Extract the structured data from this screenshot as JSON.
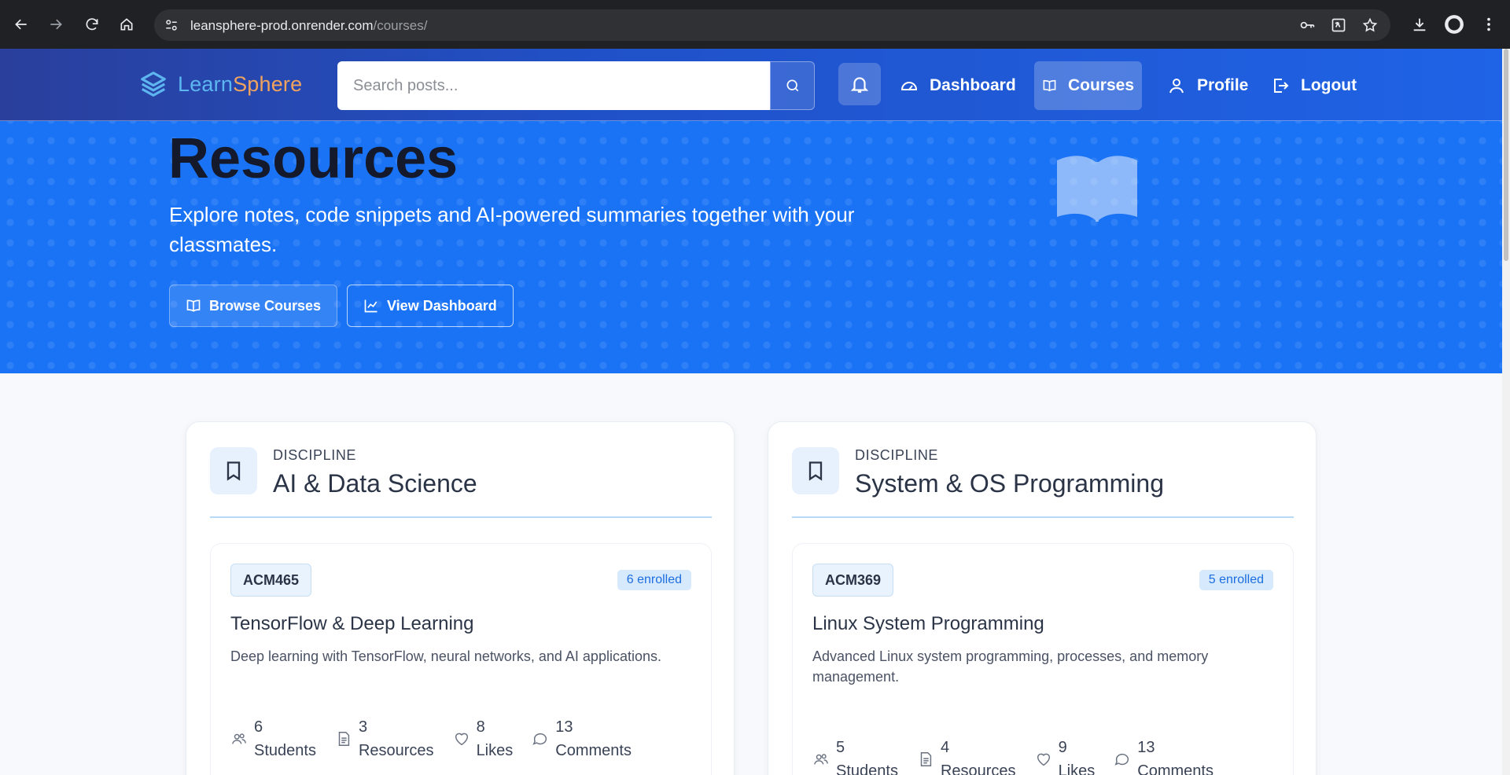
{
  "browser": {
    "url_host": "leansphere-prod.onrender.com",
    "url_path": "/courses/"
  },
  "nav": {
    "brand_prefix": "Learn",
    "brand_suffix": "Sphere",
    "search_placeholder": "Search posts...",
    "links": {
      "dashboard": "Dashboard",
      "courses": "Courses",
      "profile": "Profile",
      "logout": "Logout"
    }
  },
  "hero": {
    "title": "Resources",
    "subtitle": "Explore notes, code snippets and AI-powered summaries together with your classmates.",
    "browse_label": "Browse Courses",
    "dashboard_label": "View Dashboard"
  },
  "disciplines": [
    {
      "label": "DISCIPLINE",
      "title": "AI & Data Science",
      "course": {
        "code": "ACM465",
        "enrolled": "6 enrolled",
        "title": "TensorFlow & Deep Learning",
        "description": "Deep learning with TensorFlow, neural networks, and AI applications.",
        "stats": {
          "students_n": "6",
          "students_l": "Students",
          "resources_n": "3",
          "resources_l": "Resources",
          "likes_n": "8",
          "likes_l": "Likes",
          "comments_n": "13",
          "comments_l": "Comments"
        }
      }
    },
    {
      "label": "DISCIPLINE",
      "title": "System & OS Programming",
      "course": {
        "code": "ACM369",
        "enrolled": "5 enrolled",
        "title": "Linux System Programming",
        "description": "Advanced Linux system programming, processes, and memory management.",
        "stats": {
          "students_n": "5",
          "students_l": "Students",
          "resources_n": "4",
          "resources_l": "Resources",
          "likes_n": "9",
          "likes_l": "Likes",
          "comments_n": "13",
          "comments_l": "Comments"
        }
      }
    }
  ]
}
